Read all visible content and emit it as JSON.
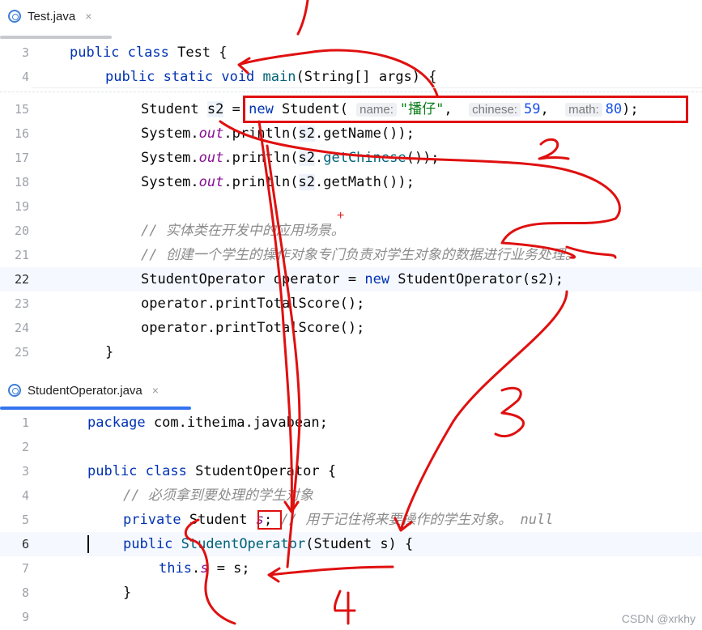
{
  "tabs": {
    "top": {
      "filename": "Test.java",
      "close": "×"
    },
    "bottom": {
      "filename": "StudentOperator.java",
      "close": "×"
    }
  },
  "test_code": {
    "lines": [
      {
        "num": "3",
        "tokens": [
          [
            "kw",
            "public"
          ],
          [
            "p",
            " "
          ],
          [
            "kw",
            "class"
          ],
          [
            "p",
            " Test {"
          ]
        ]
      },
      {
        "num": "4",
        "tokens": [
          [
            "kw",
            "public"
          ],
          [
            "p",
            " "
          ],
          [
            "kw",
            "static"
          ],
          [
            "p",
            " "
          ],
          [
            "kw",
            "void"
          ],
          [
            "p",
            " "
          ],
          [
            "mth",
            "main"
          ],
          [
            "p",
            "(String[] args) {"
          ]
        ]
      },
      {
        "num": "15",
        "tokens": [
          [
            "p",
            "Student "
          ],
          [
            "hlvar",
            "s2"
          ],
          [
            "p",
            " = "
          ],
          [
            "kw",
            "new"
          ],
          [
            "p",
            " Student( "
          ],
          [
            "hint",
            "name:"
          ],
          [
            "str",
            "\"播仔\""
          ],
          [
            "p",
            ",  "
          ],
          [
            "hint",
            "chinese:"
          ],
          [
            "num",
            "59"
          ],
          [
            "p",
            ",  "
          ],
          [
            "hint",
            "math:"
          ],
          [
            "num",
            "80"
          ],
          [
            "p",
            ");"
          ]
        ]
      },
      {
        "num": "16",
        "tokens": [
          [
            "p",
            "System."
          ],
          [
            "fld",
            "out"
          ],
          [
            "p",
            ".println("
          ],
          [
            "hlvar",
            "s2"
          ],
          [
            "p",
            ".getName());"
          ]
        ]
      },
      {
        "num": "17",
        "tokens": [
          [
            "p",
            "System."
          ],
          [
            "fld",
            "out"
          ],
          [
            "p",
            ".println("
          ],
          [
            "hlvar",
            "s2"
          ],
          [
            "p",
            "."
          ],
          [
            "mth",
            "getChinese"
          ],
          [
            "p",
            "());"
          ]
        ]
      },
      {
        "num": "18",
        "tokens": [
          [
            "p",
            "System."
          ],
          [
            "fld",
            "out"
          ],
          [
            "p",
            ".println("
          ],
          [
            "hlvar",
            "s2"
          ],
          [
            "p",
            ".getMath());"
          ]
        ]
      },
      {
        "num": "19",
        "tokens": []
      },
      {
        "num": "20",
        "tokens": [
          [
            "cm",
            "// 实体类在开发中的应用场景。"
          ]
        ]
      },
      {
        "num": "21",
        "tokens": [
          [
            "cm",
            "// 创建一个学生的操作对象专门负责对学生对象的数据进行业务处理。"
          ]
        ]
      },
      {
        "num": "22",
        "tokens": [
          [
            "p",
            "StudentOperator operator = "
          ],
          [
            "kw",
            "new"
          ],
          [
            "p",
            " StudentOperator(s2);"
          ]
        ]
      },
      {
        "num": "23",
        "tokens": [
          [
            "p",
            "operator.printTotalScore();"
          ]
        ]
      },
      {
        "num": "24",
        "tokens": [
          [
            "p",
            "operator.printTotalScore();"
          ]
        ]
      },
      {
        "num": "25",
        "tokens": [
          [
            "p",
            "}"
          ]
        ]
      }
    ]
  },
  "operator_code": {
    "lines": [
      {
        "num": "1",
        "tokens": [
          [
            "kw",
            "package"
          ],
          [
            "p",
            " com.itheima.javabean;"
          ]
        ]
      },
      {
        "num": "2",
        "tokens": []
      },
      {
        "num": "3",
        "tokens": [
          [
            "kw",
            "public"
          ],
          [
            "p",
            " "
          ],
          [
            "kw",
            "class"
          ],
          [
            "p",
            " StudentOperator {"
          ]
        ]
      },
      {
        "num": "4",
        "tokens": [
          [
            "cm",
            "// 必须拿到要处理的学生对象"
          ]
        ]
      },
      {
        "num": "5",
        "tokens": [
          [
            "kw",
            "private"
          ],
          [
            "p",
            " Student "
          ],
          [
            "fld",
            "s"
          ],
          [
            "p",
            "; "
          ],
          [
            "cm",
            "// 用于记住将来要操作的学生对象。 null"
          ]
        ]
      },
      {
        "num": "6",
        "tokens": [
          [
            "kw",
            "public"
          ],
          [
            "p",
            " "
          ],
          [
            "mth",
            "StudentOperator"
          ],
          [
            "p",
            "(Student s) {"
          ]
        ]
      },
      {
        "num": "7",
        "tokens": [
          [
            "kw",
            "this"
          ],
          [
            "p",
            "."
          ],
          [
            "fld",
            "s"
          ],
          [
            "p",
            " = s;"
          ]
        ]
      },
      {
        "num": "8",
        "tokens": [
          [
            "p",
            "}"
          ]
        ]
      },
      {
        "num": "9",
        "tokens": []
      }
    ]
  },
  "annotations": {
    "step2": "2",
    "step3": "3",
    "step4": "4"
  },
  "watermark": "CSDN @xrkhy",
  "colors": {
    "annotation_red": "#e01010",
    "tab_active_blue": "#3574f0"
  }
}
